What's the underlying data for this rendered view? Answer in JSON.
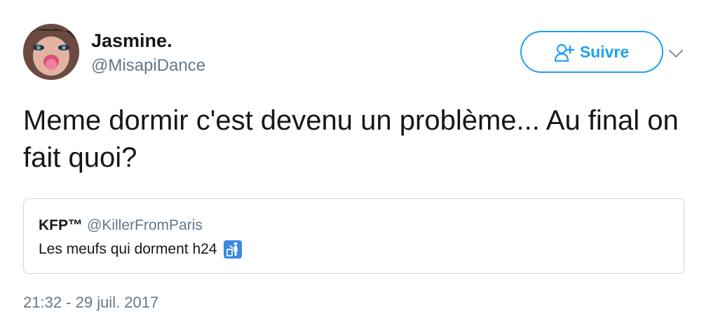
{
  "author": {
    "display_name": "Jasmine.",
    "handle": "@MisapiDance",
    "avatar_icon": "profile-photo"
  },
  "follow_button": {
    "label": "Suivre",
    "icon": "follow-person-plus-icon",
    "color": "#1da1f2"
  },
  "menu_icon": "chevron-down-icon",
  "tweet": {
    "text": "Meme dormir c'est devenu un problème... Au final on fait quoi?",
    "timestamp": "21:32 - 29 juil. 2017"
  },
  "quoted_tweet": {
    "display_name": "KFP™",
    "handle": "@KillerFromParis",
    "text": "Les meufs qui dorment h24",
    "emoji_icon": "put-litter-in-its-place-icon",
    "emoji_color": "#3b88e0"
  }
}
